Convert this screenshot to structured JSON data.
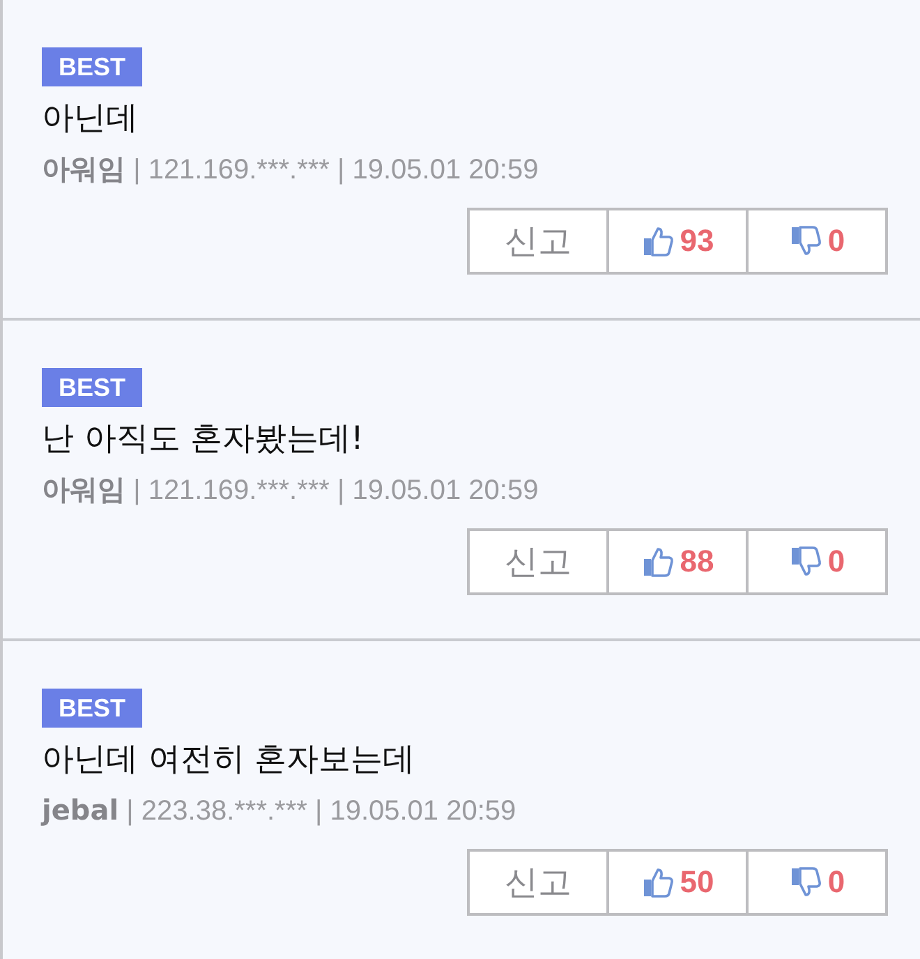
{
  "comments": [
    {
      "badge": "BEST",
      "text": "아닌데",
      "author": "아워임",
      "info": "| 121.169.***.*** | 19.05.01 20:59",
      "report": "신고",
      "likes": "93",
      "dislikes": "0"
    },
    {
      "badge": "BEST",
      "text": "난 아직도 혼자봤는데!",
      "author": "아워임",
      "info": "| 121.169.***.*** | 19.05.01 20:59",
      "report": "신고",
      "likes": "88",
      "dislikes": "0"
    },
    {
      "badge": "BEST",
      "text": "아닌데 여전히 혼자보는데",
      "author": "jebal",
      "info": "| 223.38.***.*** | 19.05.01 20:59",
      "report": "신고",
      "likes": "50",
      "dislikes": "0"
    }
  ]
}
